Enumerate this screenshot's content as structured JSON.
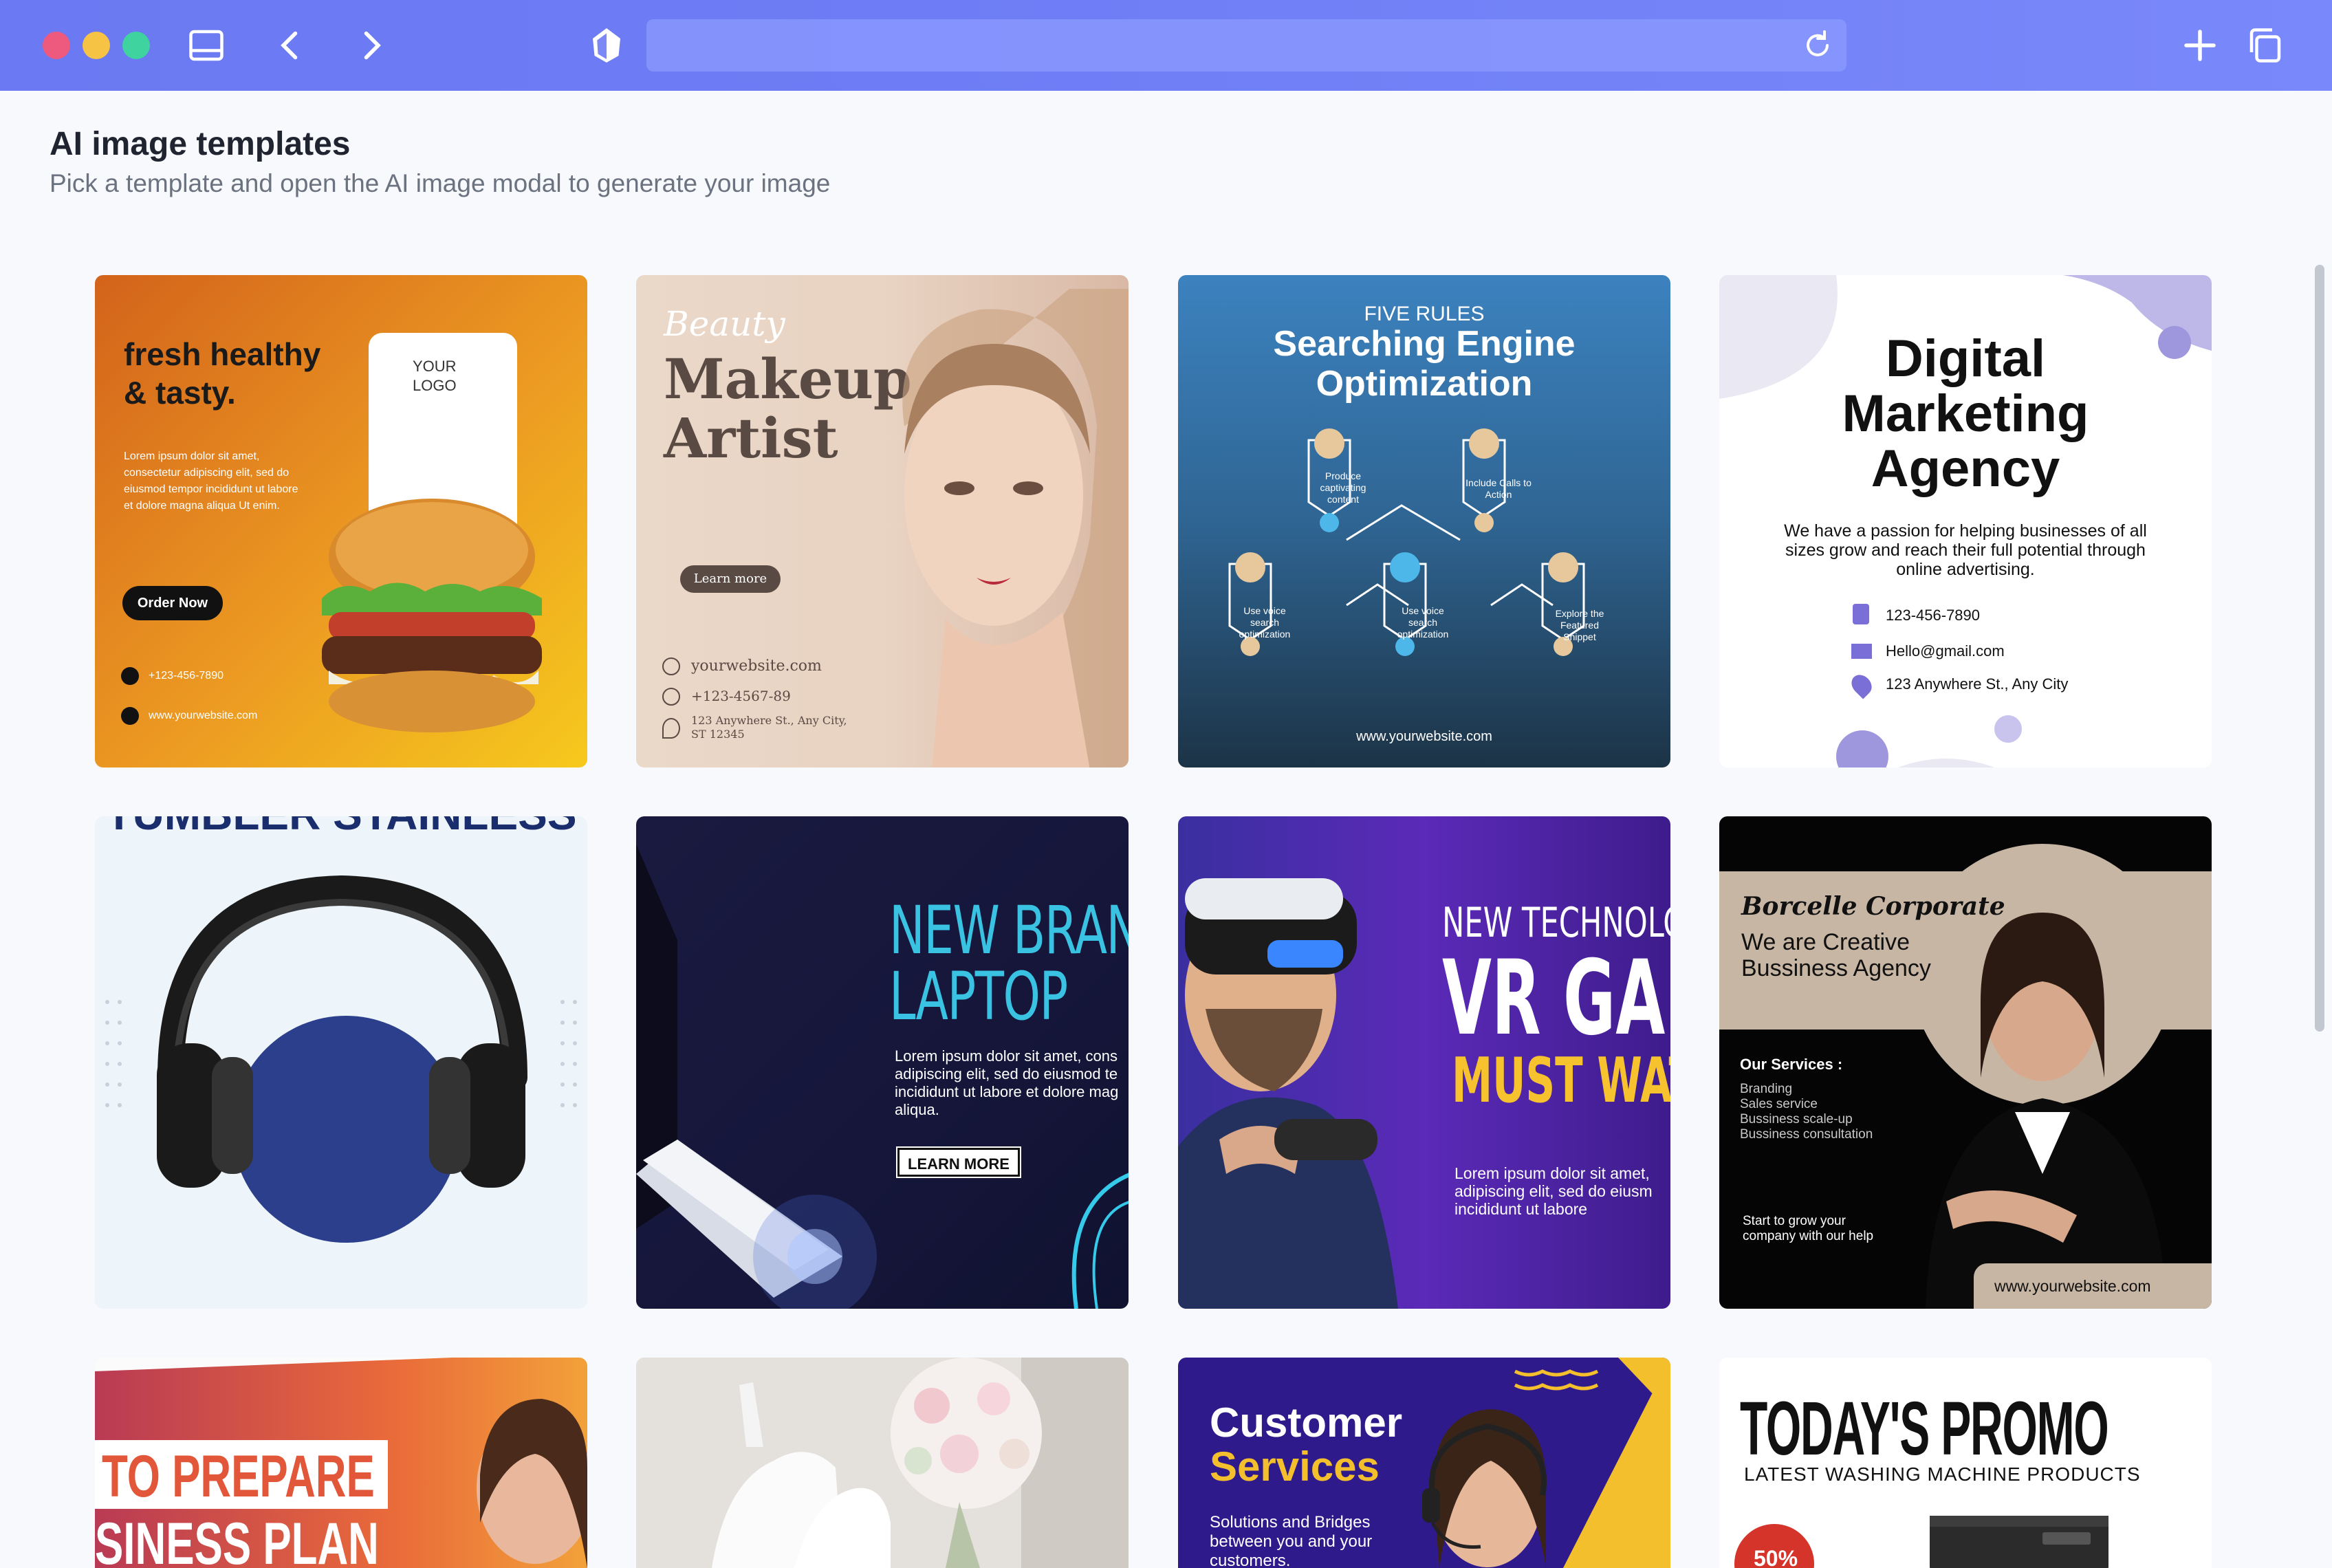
{
  "toolbar": {
    "url_value": "",
    "colors": {
      "close": "#ee5a7e",
      "minimize": "#f6c344",
      "maximize": "#3ed39f"
    }
  },
  "header": {
    "title": "AI image templates",
    "subtitle": "Pick a template and open the AI image modal to generate your image"
  },
  "templates": {
    "burger": {
      "headline_1": "fresh healthy",
      "headline_2": "& tasty.",
      "logo_1": "YOUR",
      "logo_2": "LOGO",
      "body": [
        "Lorem ipsum dolor sit amet,",
        "consectetur adipiscing elit, sed do",
        "eiusmod tempor incididunt ut labore",
        "et dolore magna aliqua Ut enim."
      ],
      "cta": "Order Now",
      "phone": "+123-456-7890",
      "website": "www.yourwebsite.com"
    },
    "makeup": {
      "script": "Beauty",
      "title_1": "Makeup",
      "title_2": "Artist",
      "cta": "Learn more",
      "website": "yourwebsite.com",
      "phone": "+123-4567-89",
      "address_1": "123 Anywhere St., Any City,",
      "address_2": "ST 12345"
    },
    "seo": {
      "kicker": "FIVE RULES",
      "title_1": "Searching Engine",
      "title_2": "Optimization",
      "rules": [
        "Produce captivating content",
        "Include Calls to Action",
        "Use voice search optimization",
        "Use voice search optimization",
        "Explore the Featured Snippet"
      ],
      "website": "www.yourwebsite.com"
    },
    "marketing": {
      "title_1": "Digital",
      "title_2": "Marketing",
      "title_3": "Agency",
      "body_1": "We have a passion for helping businesses of all",
      "body_2": "sizes grow and reach their full potential through",
      "body_3": "online advertising.",
      "phone": "123-456-7890",
      "email": "Hello@gmail.com",
      "address": "123 Anywhere St., Any City"
    },
    "headphones": {
      "cut_title": "TUMBLER STAINLESS"
    },
    "laptop": {
      "title_1": "NEW BRAN",
      "title_2": "LAPTOP",
      "body": [
        "Lorem ipsum dolor sit amet, cons",
        "adipiscing elit, sed do eiusmod te",
        "incididunt ut labore et dolore mag",
        "aliqua."
      ],
      "cta": "LEARN MORE"
    },
    "vr": {
      "line_1": "NEW TECHNOLOG",
      "line_2": "VR GA",
      "line_3": "MUST WAT",
      "body": [
        "Lorem ipsum dolor sit amet,",
        "adipiscing elit, sed do eiusm",
        "incididunt ut labore"
      ]
    },
    "corporate": {
      "script": "Borcelle Corporate",
      "title_1": "We are Creative",
      "title_2": "Bussiness Agency",
      "services_label": "Our Services :",
      "services": [
        "Branding",
        "Sales service",
        "Bussiness scale-up",
        "Bussiness consultation"
      ],
      "tag_1": "Start to grow your",
      "tag_2": "company with our help",
      "website": "www.yourwebsite.com"
    },
    "business": {
      "line_1": "TO PREPARE",
      "line_2": "SINESS PLAN"
    },
    "wedding": {},
    "customer": {
      "title_1": "Customer",
      "title_2": "Services",
      "body": [
        "Solutions and Bridges",
        "between you and your",
        "customers."
      ]
    },
    "promo": {
      "title": "TODAY'S PROMO",
      "subtitle": "LATEST WASHING MACHINE PRODUCTS",
      "badge": "50%"
    }
  }
}
